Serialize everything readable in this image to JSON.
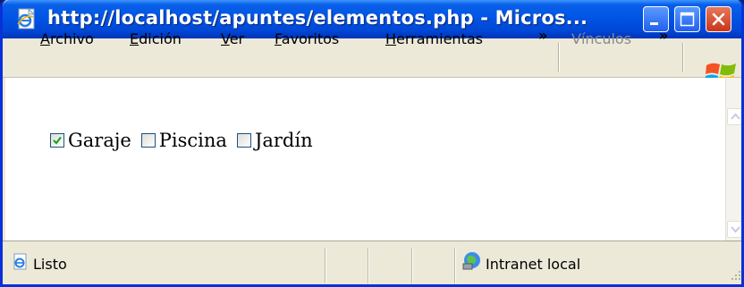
{
  "window": {
    "title": "http://localhost/apuntes/elementos.php - Micros...",
    "title_icon": "ie-page-icon",
    "controls": [
      "minimize-icon",
      "maximize-icon",
      "close-icon"
    ]
  },
  "menu": {
    "items": [
      {
        "accel": "A",
        "rest": "rchivo"
      },
      {
        "accel": "E",
        "rest": "dición"
      },
      {
        "accel": "V",
        "rest": "er"
      },
      {
        "accel": "F",
        "rest": "avoritos"
      },
      {
        "accel": "H",
        "rest": "erramientas"
      }
    ],
    "overflow": "»",
    "links_label": "Vínculos",
    "links_overflow": "»"
  },
  "page": {
    "checkboxes": [
      {
        "label": "Garaje",
        "checked": true
      },
      {
        "label": "Piscina",
        "checked": false
      },
      {
        "label": "Jardín",
        "checked": false
      }
    ]
  },
  "status": {
    "text": "Listo",
    "zone": "Intranet local"
  },
  "colors": {
    "titlebar": "#0055e5",
    "check": "#21a121",
    "checkbox_border": "#1c5180"
  }
}
